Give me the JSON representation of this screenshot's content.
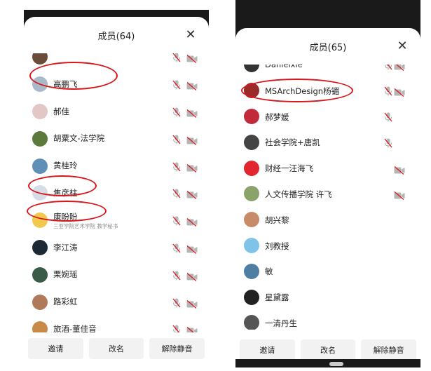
{
  "left": {
    "title": "成员(64)",
    "close_symbol": "✕",
    "members": [
      {
        "name": "",
        "avatar_color": "#6b4b3a",
        "mic": true,
        "cam": true
      },
      {
        "name": "高鹏飞",
        "avatar_color": "#a9b9c9",
        "mic": true,
        "cam": true
      },
      {
        "name": "郝佳",
        "avatar_color": "#e3c6c6",
        "mic": true,
        "cam": true
      },
      {
        "name": "胡粟文-法学院",
        "avatar_color": "#5b7a3b",
        "mic": true,
        "cam": true
      },
      {
        "name": "黄桂玲",
        "avatar_color": "#5f8fb6",
        "mic": true,
        "cam": true
      },
      {
        "name": "焦彦柱",
        "avatar_color": "#d6dde6",
        "mic": true,
        "cam": true
      },
      {
        "name": "康盼盼",
        "subname": "三亚学院艺术学院 教学秘书",
        "avatar_color": "#f2c94c",
        "mic": true,
        "cam": true
      },
      {
        "name": "李江涛",
        "avatar_color": "#1b2a34",
        "mic": true,
        "cam": true
      },
      {
        "name": "栗婉瑶",
        "avatar_color": "#3a5b47",
        "mic": true,
        "cam": true
      },
      {
        "name": "路彩虹",
        "avatar_color": "#b07a5a",
        "mic": true,
        "cam": true
      },
      {
        "name": "旅酒-董佳音",
        "avatar_color": "#c98a48",
        "mic": true,
        "cam": true
      }
    ],
    "buttons": {
      "invite": "邀请",
      "rename": "改名",
      "unmute": "解除静音"
    }
  },
  "right": {
    "title": "成员(65)",
    "close_symbol": "✕",
    "status_left": "",
    "status_time": "",
    "members": [
      {
        "name": "Danielxie",
        "avatar_color": "#333333",
        "mic": true,
        "cam": true
      },
      {
        "name": "MSArchDesign杨镅",
        "avatar_color": "#9b2a2a",
        "mic": true,
        "cam": true
      },
      {
        "name": "郝梦媛",
        "avatar_color": "#c22a3a",
        "mic": true,
        "cam": false
      },
      {
        "name": "社会学院+唐凯",
        "avatar_color": "#444444",
        "mic": true,
        "cam": false
      },
      {
        "name": "财经一汪海飞",
        "avatar_color": "#e1262f",
        "mic": false,
        "cam": true
      },
      {
        "name": "人文传播学院 许飞",
        "avatar_color": "#8aa36a",
        "mic": false,
        "cam": true
      },
      {
        "name": "胡兴黎",
        "avatar_color": "#c98a6a",
        "mic": false,
        "cam": false
      },
      {
        "name": "刘教授",
        "avatar_color": "#7fc4e8",
        "mic": false,
        "cam": false
      },
      {
        "name": "敏",
        "avatar_color": "#4f7ea3",
        "mic": false,
        "cam": false
      },
      {
        "name": "星黛露",
        "avatar_color": "#222222",
        "mic": false,
        "cam": false
      },
      {
        "name": "一清丹生",
        "avatar_color": "#555555",
        "mic": false,
        "cam": false
      }
    ],
    "buttons": {
      "invite": "邀请",
      "rename": "改名",
      "unmute": "解除静音"
    }
  },
  "colors": {
    "accent_red": "#d9161c",
    "icon_gray": "#b5b5b5",
    "sheet_bg": "#ffffff",
    "button_bg": "#f2f2f2"
  }
}
